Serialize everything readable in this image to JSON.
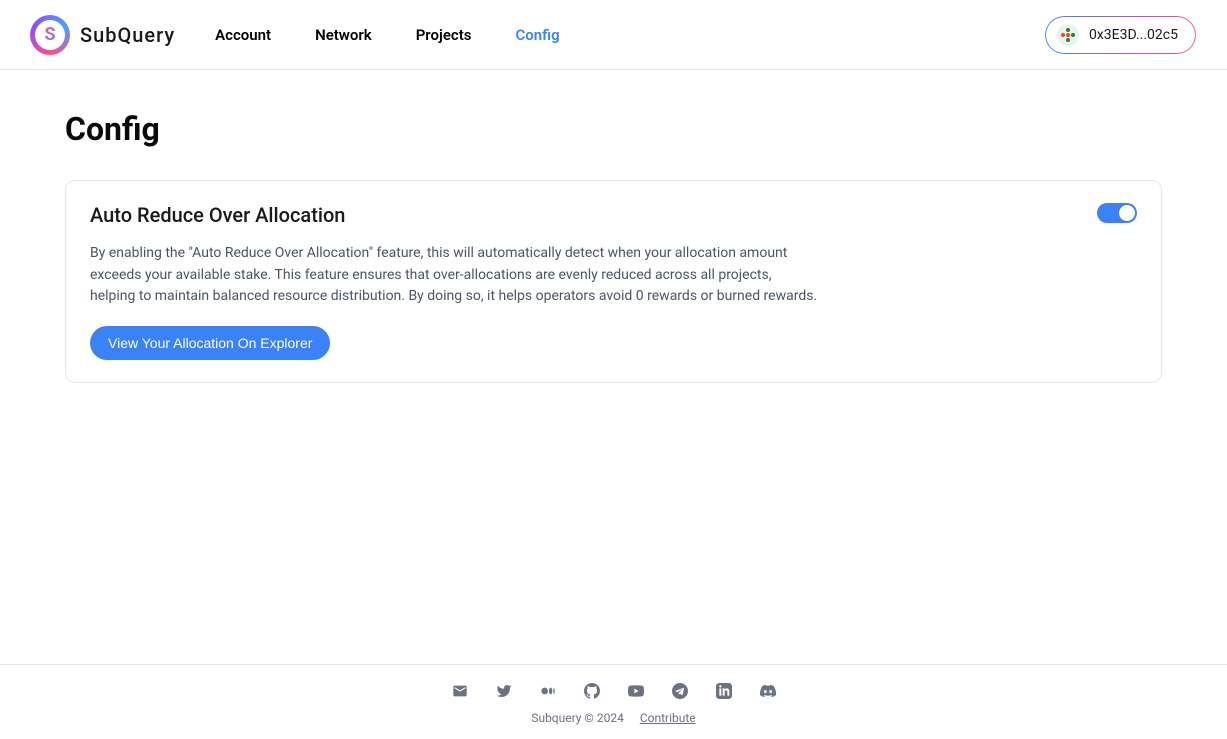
{
  "header": {
    "brand": "SubQuery",
    "nav": [
      {
        "label": "Account",
        "active": false
      },
      {
        "label": "Network",
        "active": false
      },
      {
        "label": "Projects",
        "active": false
      },
      {
        "label": "Config",
        "active": true
      }
    ],
    "wallet_address": "0x3E3D...02c5"
  },
  "page": {
    "title": "Config",
    "card": {
      "title": "Auto Reduce Over Allocation",
      "description": "By enabling the \"Auto Reduce Over Allocation\" feature, this will automatically detect when your allocation amount exceeds your available stake. This feature ensures that over-allocations are evenly reduced across all projects, helping to maintain balanced resource distribution. By doing so, it helps operators avoid 0 rewards or burned rewards.",
      "button_label": "View Your Allocation On Explorer",
      "toggle_on": true
    }
  },
  "footer": {
    "copyright": "Subquery © 2024",
    "contribute_label": "Contribute",
    "socials": [
      "mail-icon",
      "twitter-icon",
      "medium-icon",
      "github-icon",
      "youtube-icon",
      "telegram-icon",
      "linkedin-icon",
      "discord-icon"
    ]
  }
}
